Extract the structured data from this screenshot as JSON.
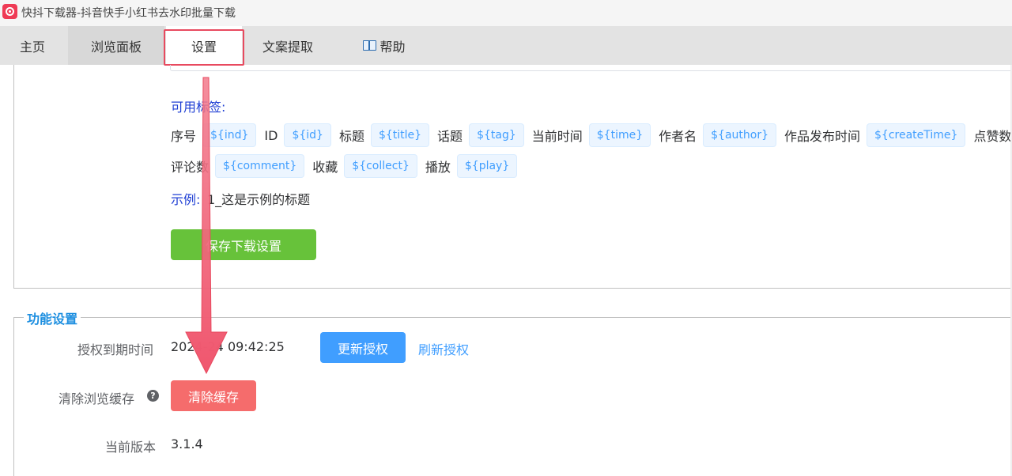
{
  "window": {
    "title": "快抖下载器-抖音快手小红书去水印批量下载",
    "logo_icon": "app-logo-icon",
    "logo_color": "#ef3b55"
  },
  "tabs": [
    {
      "label": "主页"
    },
    {
      "label": "浏览面板"
    },
    {
      "label": "设置",
      "active": true
    },
    {
      "label": "文案提取"
    },
    {
      "label": "帮助",
      "icon": "book-icon"
    }
  ],
  "naming": {
    "available_tags_label": "可用标签:",
    "tags_row1": [
      {
        "name": "序号",
        "tag": "${ind}"
      },
      {
        "name": "ID",
        "tag": "${id}"
      },
      {
        "name": "标题",
        "tag": "${title}"
      },
      {
        "name": "话题",
        "tag": "${tag}"
      },
      {
        "name": "当前时间",
        "tag": "${time}"
      },
      {
        "name": "作者名",
        "tag": "${author}"
      },
      {
        "name": "作品发布时间",
        "tag": "${createTime}"
      },
      {
        "name": "点赞数",
        "tag": "$"
      }
    ],
    "tags_row2": [
      {
        "name": "评论数",
        "tag": "${comment}"
      },
      {
        "name": "收藏",
        "tag": "${collect}"
      },
      {
        "name": "播放",
        "tag": "${play}"
      }
    ],
    "example_label": "示例:",
    "example_value": "1_这是示例的标题",
    "save_button": "保存下载设置"
  },
  "function_settings": {
    "legend": "功能设置",
    "auth_label": "授权到期时间",
    "auth_value": "2024-24 09:42:25",
    "renew_button": "更新授权",
    "refresh_link": "刷新授权",
    "clear_label": "清除浏览缓存",
    "clear_help_icon": "question-circle-icon",
    "clear_button": "清除缓存",
    "version_label": "当前版本",
    "version_value": "3.1.4"
  },
  "colors": {
    "accent": "#409eff",
    "success": "#67c23a",
    "danger": "#f56c6c",
    "annotation": "#f0566e",
    "tag_blue_label": "#1f3fd4"
  }
}
